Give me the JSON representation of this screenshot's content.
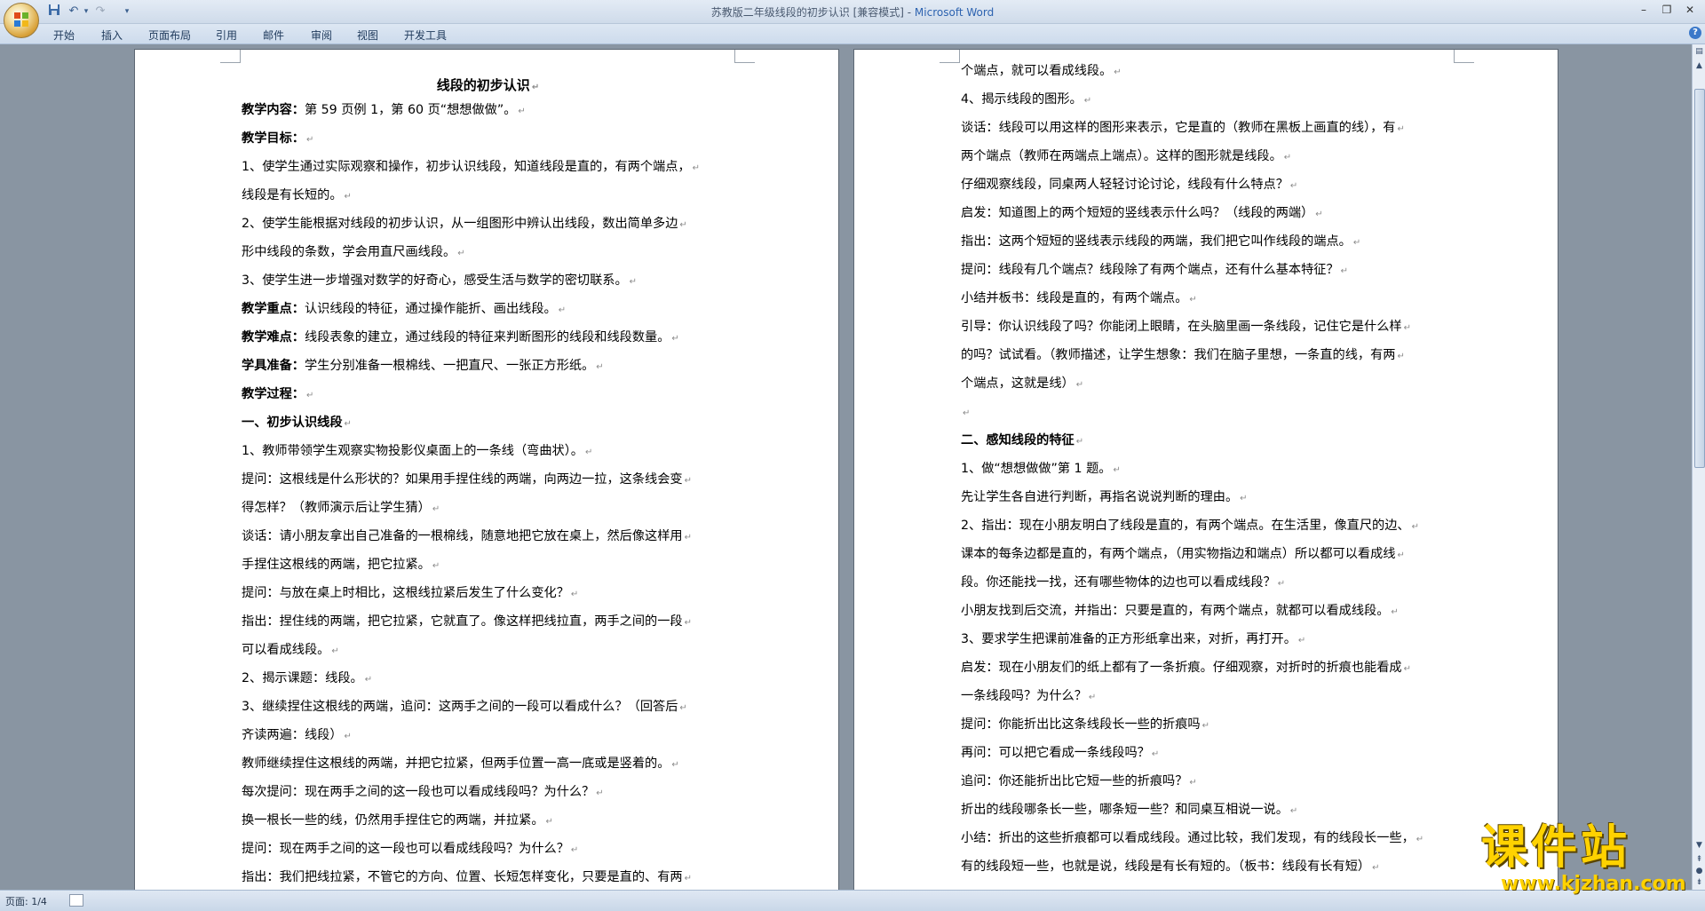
{
  "window": {
    "title_doc": "苏教版二年级线段的初步认识 [兼容模式] - ",
    "title_app": "Microsoft Word"
  },
  "ribbon": {
    "tabs": [
      "开始",
      "插入",
      "页面布局",
      "引用",
      "邮件",
      "审阅",
      "视图",
      "开发工具"
    ]
  },
  "page1": {
    "title": "线段的初步认识",
    "lines": [
      {
        "bold_part": "教学内容：",
        "text": "第 59 页例 1，第 60 页“想想做做”。"
      },
      {
        "bold_part": "教学目标：",
        "text": ""
      },
      {
        "bold_part": "",
        "text": "1、使学生通过实际观察和操作，初步认识线段，知道线段是直的，有两个端点，"
      },
      {
        "bold_part": "",
        "text": "线段是有长短的。"
      },
      {
        "bold_part": "",
        "text": "2、使学生能根据对线段的初步认识，从一组图形中辨认出线段，数出简单多边"
      },
      {
        "bold_part": "",
        "text": "形中线段的条数，学会用直尺画线段。"
      },
      {
        "bold_part": "",
        "text": "3、使学生进一步增强对数学的好奇心，感受生活与数学的密切联系。"
      },
      {
        "bold_part": "教学重点：",
        "text": "认识线段的特征，通过操作能折、画出线段。"
      },
      {
        "bold_part": "教学难点：",
        "text": "线段表象的建立，通过线段的特征来判断图形的线段和线段数量。"
      },
      {
        "bold_part": "学具准备：",
        "text": "学生分别准备一根棉线、一把直尺、一张正方形纸。"
      },
      {
        "bold_part": "教学过程：",
        "text": ""
      },
      {
        "bold_part": "一、初步认识线段",
        "text": ""
      },
      {
        "bold_part": "",
        "text": "1、教师带领学生观察实物投影仪桌面上的一条线（弯曲状）。"
      },
      {
        "bold_part": "",
        "text": "提问：这根线是什么形状的？如果用手捏住线的两端，向两边一拉，这条线会变"
      },
      {
        "bold_part": "",
        "text": "得怎样？（教师演示后让学生猜）"
      },
      {
        "bold_part": "",
        "text": "谈话：请小朋友拿出自己准备的一根棉线，随意地把它放在桌上，然后像这样用"
      },
      {
        "bold_part": "",
        "text": "手捏住这根线的两端，把它拉紧。"
      },
      {
        "bold_part": "",
        "text": "提问：与放在桌上时相比，这根线拉紧后发生了什么变化？"
      },
      {
        "bold_part": "",
        "text": "指出：捏住线的两端，把它拉紧，它就直了。像这样把线拉直，两手之间的一段"
      },
      {
        "bold_part": "",
        "text": "可以看成线段。"
      },
      {
        "bold_part": "",
        "text": "2、揭示课题：线段。"
      },
      {
        "bold_part": "",
        "text": "3、继续捏住这根线的两端，追问：这两手之间的一段可以看成什么？（回答后"
      },
      {
        "bold_part": "",
        "text": "齐读两遍：线段）"
      },
      {
        "bold_part": "",
        "text": "教师继续捏住这根线的两端，并把它拉紧，但两手位置一高一底或是竖着的。"
      },
      {
        "bold_part": "",
        "text": "每次提问：现在两手之间的这一段也可以看成线段吗？为什么？"
      },
      {
        "bold_part": "",
        "text": "换一根长一些的线，仍然用手捏住它的两端，并拉紧。"
      },
      {
        "bold_part": "",
        "text": "提问：现在两手之间的这一段也可以看成线段吗？为什么？"
      },
      {
        "bold_part": "",
        "text": "指出：我们把线拉紧，不管它的方向、位置、长短怎样变化，只要是直的、有两"
      }
    ]
  },
  "page2": {
    "lines": [
      {
        "bold_part": "",
        "text": "个端点，就可以看成线段。"
      },
      {
        "bold_part": "",
        "text": "4、揭示线段的图形。"
      },
      {
        "bold_part": "",
        "text": "谈话：线段可以用这样的图形来表示，它是直的（教师在黑板上画直的线），有"
      },
      {
        "bold_part": "",
        "text": "两个端点（教师在两端点上端点）。这样的图形就是线段。"
      },
      {
        "bold_part": "",
        "text": "仔细观察线段，同桌两人轻轻讨论讨论，线段有什么特点？"
      },
      {
        "bold_part": "",
        "text": "启发：知道图上的两个短短的竖线表示什么吗？（线段的两端）"
      },
      {
        "bold_part": "",
        "text": "指出：这两个短短的竖线表示线段的两端，我们把它叫作线段的端点。"
      },
      {
        "bold_part": "",
        "text": "提问：线段有几个端点？线段除了有两个端点，还有什么基本特征？"
      },
      {
        "bold_part": "",
        "text": "小结并板书：线段是直的，有两个端点。"
      },
      {
        "bold_part": "",
        "text": "引导：你认识线段了吗？你能闭上眼睛，在头脑里画一条线段，记住它是什么样"
      },
      {
        "bold_part": "",
        "text": "的吗？试试看。（教师描述，让学生想象：我们在脑子里想，一条直的线，有两"
      },
      {
        "bold_part": "",
        "text": "个端点，这就是线）"
      },
      {
        "bold_part": "",
        "text": ""
      },
      {
        "bold_part": "二、感知线段的特征",
        "text": ""
      },
      {
        "bold_part": "",
        "text": "1、做“想想做做”第 1 题。"
      },
      {
        "bold_part": "",
        "text": "先让学生各自进行判断，再指名说说判断的理由。"
      },
      {
        "bold_part": "",
        "text": "2、指出：现在小朋友明白了线段是直的，有两个端点。在生活里，像直尺的边、"
      },
      {
        "bold_part": "",
        "text": "课本的每条边都是直的，有两个端点，（用实物指边和端点）所以都可以看成线"
      },
      {
        "bold_part": "",
        "text": "段。你还能找一找，还有哪些物体的边也可以看成线段？"
      },
      {
        "bold_part": "",
        "text": "小朋友找到后交流，并指出：只要是直的，有两个端点，就都可以看成线段。"
      },
      {
        "bold_part": "",
        "text": "3、要求学生把课前准备的正方形纸拿出来，对折，再打开。"
      },
      {
        "bold_part": "",
        "text": "启发：现在小朋友们的纸上都有了一条折痕。仔细观察，对折时的折痕也能看成"
      },
      {
        "bold_part": "",
        "text": "一条线段吗？为什么？"
      },
      {
        "bold_part": "",
        "text": "提问：你能折出比这条线段长一些的折痕吗"
      },
      {
        "bold_part": "",
        "text": "再问：可以把它看成一条线段吗？"
      },
      {
        "bold_part": "",
        "text": "追问：你还能折出比它短一些的折痕吗？"
      },
      {
        "bold_part": "",
        "text": "折出的线段哪条长一些，哪条短一些？和同桌互相说一说。"
      },
      {
        "bold_part": "",
        "text": "小结：折出的这些折痕都可以看成线段。通过比较，我们发现，有的线段长一些，"
      },
      {
        "bold_part": "",
        "text": "有的线段短一些，也就是说，线段是有长有短的。（板书：线段有长有短）"
      },
      {
        "bold_part": "",
        "text": ""
      }
    ]
  },
  "status": {
    "page_info": "页面: 1/4"
  },
  "watermark": {
    "line1": "课件站",
    "line2": "www.kjzhan.com"
  },
  "icons": {
    "save": "save-icon",
    "undo": "undo-icon",
    "redo": "redo-icon",
    "customize": "chevron-down-icon",
    "help": "help-icon",
    "paragraph_mark": "paragraph-mark-icon"
  },
  "colors": {
    "title_app": "#2d63b0",
    "workspace": "#8995a2",
    "watermark": "#ffd200"
  }
}
